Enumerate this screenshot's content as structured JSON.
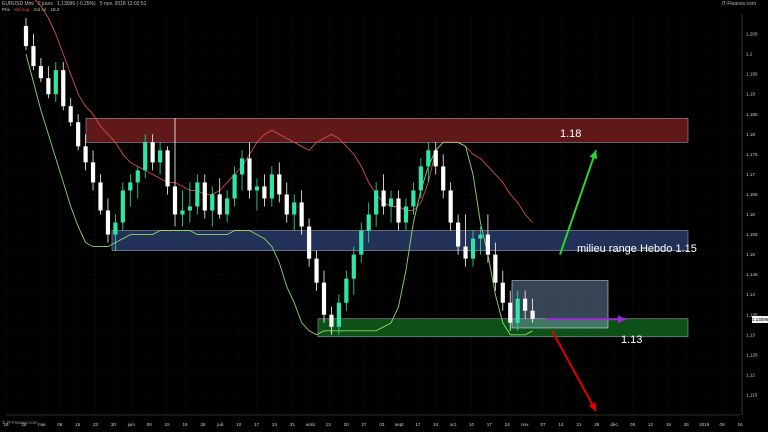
{
  "header": {
    "instrument": "EURUSD Mini",
    "period": "2 jours",
    "last": "1,13096 (-0,25%)",
    "datetime": "5 nov. 2018 12:02:51",
    "indicators": [
      {
        "label": "Prix",
        "color": "#cfcfcf"
      },
      {
        "label": "Std sup",
        "color": "#e05050"
      },
      {
        "label": "Std inf",
        "color": "#8fd06a"
      },
      {
        "label": "",
        "color": "#cfcfcf"
      },
      {
        "label": "18.2",
        "color": "#cfcfcf"
      }
    ],
    "brand": "IT-Finance.com"
  },
  "footer": {
    "copyright": "© IT-Finance.com"
  },
  "price_tag": "1.13096",
  "zones": {
    "resistance_label": "1.18",
    "middle_label": "milieu range Hebdo 1.15",
    "support_label": "1.13"
  },
  "colors": {
    "background": "#000000",
    "bull_candle": "#2ee6a8",
    "bear_candle": "#ffffff",
    "upper_band": "#d54c4c",
    "lower_band": "#8fd66a",
    "resistance_zone": "#6b1b1b",
    "middle_zone": "#283a66",
    "support_zone": "#0f5a1a",
    "arrow_up": "#2bd62b",
    "arrow_down": "#e00000",
    "arrow_right": "#9a2be0"
  },
  "chart_data": {
    "type": "candlestick",
    "symbol": "EURUSD",
    "ylim": [
      1.11,
      1.21
    ],
    "y_ticks": [
      "1,205",
      "1,2",
      "1,195",
      "1,19",
      "1,185",
      "1,18",
      "1,175",
      "1,17",
      "1,165",
      "1,16",
      "1,155",
      "1,15",
      "1,145",
      "1,14",
      "1,135",
      "1,13",
      "1,125",
      "1,12",
      "1,115"
    ],
    "x_ticks": [
      "18",
      "25",
      "mai",
      "08",
      "15",
      "23",
      "30",
      "juin",
      "08",
      "15",
      "19",
      "26",
      "juil.",
      "10",
      "17",
      "24",
      "31",
      "août",
      "13",
      "20",
      "27",
      "03",
      "sept.",
      "17",
      "24",
      "oct.",
      "10",
      "17",
      "24",
      "nov.",
      "07",
      "14",
      "21",
      "28",
      "déc.",
      "05",
      "12",
      "19",
      "26",
      "2019",
      "09",
      "16"
    ],
    "candles": [
      {
        "o": 1.207,
        "h": 1.209,
        "l": 1.201,
        "c": 1.202
      },
      {
        "o": 1.202,
        "h": 1.205,
        "l": 1.196,
        "c": 1.197
      },
      {
        "o": 1.197,
        "h": 1.199,
        "l": 1.193,
        "c": 1.194
      },
      {
        "o": 1.194,
        "h": 1.197,
        "l": 1.189,
        "c": 1.19
      },
      {
        "o": 1.19,
        "h": 1.198,
        "l": 1.188,
        "c": 1.196
      },
      {
        "o": 1.196,
        "h": 1.198,
        "l": 1.186,
        "c": 1.187
      },
      {
        "o": 1.187,
        "h": 1.189,
        "l": 1.182,
        "c": 1.183
      },
      {
        "o": 1.183,
        "h": 1.185,
        "l": 1.176,
        "c": 1.177
      },
      {
        "o": 1.177,
        "h": 1.18,
        "l": 1.171,
        "c": 1.173
      },
      {
        "o": 1.173,
        "h": 1.176,
        "l": 1.166,
        "c": 1.168
      },
      {
        "o": 1.168,
        "h": 1.17,
        "l": 1.16,
        "c": 1.161
      },
      {
        "o": 1.161,
        "h": 1.164,
        "l": 1.153,
        "c": 1.155
      },
      {
        "o": 1.155,
        "h": 1.16,
        "l": 1.151,
        "c": 1.158
      },
      {
        "o": 1.158,
        "h": 1.168,
        "l": 1.156,
        "c": 1.166
      },
      {
        "o": 1.166,
        "h": 1.17,
        "l": 1.162,
        "c": 1.168
      },
      {
        "o": 1.168,
        "h": 1.172,
        "l": 1.164,
        "c": 1.171
      },
      {
        "o": 1.171,
        "h": 1.18,
        "l": 1.169,
        "c": 1.178
      },
      {
        "o": 1.178,
        "h": 1.18,
        "l": 1.171,
        "c": 1.173
      },
      {
        "o": 1.173,
        "h": 1.178,
        "l": 1.17,
        "c": 1.176
      },
      {
        "o": 1.176,
        "h": 1.177,
        "l": 1.165,
        "c": 1.167
      },
      {
        "o": 1.167,
        "h": 1.184,
        "l": 1.157,
        "c": 1.16
      },
      {
        "o": 1.16,
        "h": 1.166,
        "l": 1.157,
        "c": 1.161
      },
      {
        "o": 1.161,
        "h": 1.168,
        "l": 1.158,
        "c": 1.162
      },
      {
        "o": 1.162,
        "h": 1.17,
        "l": 1.16,
        "c": 1.168
      },
      {
        "o": 1.168,
        "h": 1.17,
        "l": 1.159,
        "c": 1.161
      },
      {
        "o": 1.161,
        "h": 1.167,
        "l": 1.157,
        "c": 1.165
      },
      {
        "o": 1.165,
        "h": 1.169,
        "l": 1.159,
        "c": 1.16
      },
      {
        "o": 1.16,
        "h": 1.166,
        "l": 1.158,
        "c": 1.164
      },
      {
        "o": 1.164,
        "h": 1.172,
        "l": 1.162,
        "c": 1.17
      },
      {
        "o": 1.17,
        "h": 1.176,
        "l": 1.166,
        "c": 1.174
      },
      {
        "o": 1.174,
        "h": 1.178,
        "l": 1.164,
        "c": 1.166
      },
      {
        "o": 1.166,
        "h": 1.169,
        "l": 1.161,
        "c": 1.167
      },
      {
        "o": 1.167,
        "h": 1.17,
        "l": 1.162,
        "c": 1.164
      },
      {
        "o": 1.164,
        "h": 1.172,
        "l": 1.162,
        "c": 1.17
      },
      {
        "o": 1.17,
        "h": 1.173,
        "l": 1.163,
        "c": 1.165
      },
      {
        "o": 1.165,
        "h": 1.168,
        "l": 1.158,
        "c": 1.16
      },
      {
        "o": 1.16,
        "h": 1.165,
        "l": 1.156,
        "c": 1.163
      },
      {
        "o": 1.163,
        "h": 1.166,
        "l": 1.155,
        "c": 1.157
      },
      {
        "o": 1.157,
        "h": 1.159,
        "l": 1.147,
        "c": 1.149
      },
      {
        "o": 1.149,
        "h": 1.151,
        "l": 1.141,
        "c": 1.143
      },
      {
        "o": 1.143,
        "h": 1.146,
        "l": 1.133,
        "c": 1.135
      },
      {
        "o": 1.135,
        "h": 1.137,
        "l": 1.13,
        "c": 1.132
      },
      {
        "o": 1.132,
        "h": 1.14,
        "l": 1.13,
        "c": 1.138
      },
      {
        "o": 1.138,
        "h": 1.146,
        "l": 1.136,
        "c": 1.144
      },
      {
        "o": 1.144,
        "h": 1.152,
        "l": 1.14,
        "c": 1.15
      },
      {
        "o": 1.15,
        "h": 1.158,
        "l": 1.148,
        "c": 1.156
      },
      {
        "o": 1.156,
        "h": 1.163,
        "l": 1.153,
        "c": 1.16
      },
      {
        "o": 1.16,
        "h": 1.168,
        "l": 1.157,
        "c": 1.166
      },
      {
        "o": 1.166,
        "h": 1.17,
        "l": 1.16,
        "c": 1.162
      },
      {
        "o": 1.162,
        "h": 1.166,
        "l": 1.158,
        "c": 1.164
      },
      {
        "o": 1.164,
        "h": 1.166,
        "l": 1.156,
        "c": 1.158
      },
      {
        "o": 1.158,
        "h": 1.164,
        "l": 1.156,
        "c": 1.162
      },
      {
        "o": 1.162,
        "h": 1.168,
        "l": 1.16,
        "c": 1.166
      },
      {
        "o": 1.166,
        "h": 1.174,
        "l": 1.164,
        "c": 1.172
      },
      {
        "o": 1.172,
        "h": 1.178,
        "l": 1.168,
        "c": 1.176
      },
      {
        "o": 1.176,
        "h": 1.178,
        "l": 1.17,
        "c": 1.172
      },
      {
        "o": 1.172,
        "h": 1.175,
        "l": 1.164,
        "c": 1.166
      },
      {
        "o": 1.166,
        "h": 1.168,
        "l": 1.156,
        "c": 1.158
      },
      {
        "o": 1.158,
        "h": 1.16,
        "l": 1.15,
        "c": 1.152
      },
      {
        "o": 1.152,
        "h": 1.16,
        "l": 1.147,
        "c": 1.149
      },
      {
        "o": 1.149,
        "h": 1.156,
        "l": 1.147,
        "c": 1.154
      },
      {
        "o": 1.154,
        "h": 1.157,
        "l": 1.15,
        "c": 1.155
      },
      {
        "o": 1.155,
        "h": 1.16,
        "l": 1.148,
        "c": 1.15
      },
      {
        "o": 1.15,
        "h": 1.153,
        "l": 1.141,
        "c": 1.143
      },
      {
        "o": 1.143,
        "h": 1.146,
        "l": 1.136,
        "c": 1.138
      },
      {
        "o": 1.138,
        "h": 1.141,
        "l": 1.131,
        "c": 1.133
      },
      {
        "o": 1.133,
        "h": 1.141,
        "l": 1.131,
        "c": 1.139
      },
      {
        "o": 1.139,
        "h": 1.141,
        "l": 1.134,
        "c": 1.136
      },
      {
        "o": 1.136,
        "h": 1.139,
        "l": 1.133,
        "c": 1.134
      }
    ],
    "upper_band": [
      1.215,
      1.214,
      1.212,
      1.209,
      1.205,
      1.2,
      1.195,
      1.19,
      1.187,
      1.185,
      1.182,
      1.18,
      1.178,
      1.175,
      1.173,
      1.172,
      1.171,
      1.17,
      1.169,
      1.168,
      1.168,
      1.167,
      1.166,
      1.166,
      1.165,
      1.165,
      1.166,
      1.168,
      1.17,
      1.172,
      1.175,
      1.178,
      1.18,
      1.181,
      1.18,
      1.179,
      1.178,
      1.177,
      1.176,
      1.178,
      1.179,
      1.18,
      1.179,
      1.177,
      1.175,
      1.172,
      1.168,
      1.165,
      1.163,
      1.162,
      1.162,
      1.161,
      1.161,
      1.163,
      1.168,
      1.176,
      1.178,
      1.178,
      1.178,
      1.177,
      1.175,
      1.174,
      1.172,
      1.17,
      1.168,
      1.165,
      1.163,
      1.16,
      1.158
    ],
    "lower_band": [
      1.2,
      1.193,
      1.186,
      1.18,
      1.174,
      1.168,
      1.162,
      1.157,
      1.153,
      1.152,
      1.152,
      1.152,
      1.153,
      1.154,
      1.155,
      1.155,
      1.155,
      1.155,
      1.156,
      1.156,
      1.156,
      1.156,
      1.156,
      1.155,
      1.155,
      1.155,
      1.155,
      1.155,
      1.156,
      1.156,
      1.156,
      1.155,
      1.154,
      1.152,
      1.148,
      1.142,
      1.138,
      1.133,
      1.131,
      1.13,
      1.131,
      1.131,
      1.131,
      1.131,
      1.131,
      1.131,
      1.131,
      1.131,
      1.132,
      1.133,
      1.137,
      1.146,
      1.158,
      1.166,
      1.172,
      1.176,
      1.178,
      1.178,
      1.178,
      1.177,
      1.17,
      1.158,
      1.15,
      1.14,
      1.133,
      1.13,
      1.13,
      1.13,
      1.131
    ],
    "zones": [
      {
        "name": "1.18",
        "from": 1.178,
        "to": 1.184
      },
      {
        "name": "milieu range Hebdo 1.15",
        "from": 1.151,
        "to": 1.156
      },
      {
        "name": "1.13",
        "from": 1.1295,
        "to": 1.134
      }
    ],
    "arrows": [
      {
        "direction": "up",
        "from": 1.15,
        "to": 1.176
      },
      {
        "direction": "down",
        "from": 1.131,
        "to": 1.111
      },
      {
        "direction": "right",
        "level": 1.134
      }
    ]
  }
}
